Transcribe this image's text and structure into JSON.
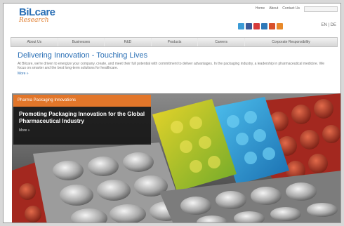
{
  "header": {
    "logo_main": "BiLcare",
    "logo_sub": "Research",
    "top_links": [
      "Home",
      "About",
      "Contact Us"
    ],
    "language": "EN | DE",
    "social_icons": [
      {
        "name": "twitter-icon",
        "color": "#3b9bd6"
      },
      {
        "name": "facebook-icon",
        "color": "#3b5998"
      },
      {
        "name": "youtube-icon",
        "color": "#d63b3b"
      },
      {
        "name": "linkedin-icon",
        "color": "#2f79b8"
      },
      {
        "name": "flickr-icon",
        "color": "#d8502a"
      },
      {
        "name": "rss-icon",
        "color": "#e8892a"
      }
    ]
  },
  "nav": {
    "items": [
      "About Us",
      "Businesses",
      "R&D",
      "Products",
      "Careers",
      "Corporate Responsibility"
    ]
  },
  "intro": {
    "title": "Delivering Innovation - Touching Lives",
    "body": "At Bilcare, we're driven to energize your company, create, and meet their full potential with commitment to deliver advantages. In the packaging industry, a leadership in pharmaceutical medicine. We focus on smarter and the best long-term solutions for healthcare.",
    "more": "More »"
  },
  "banner": {
    "tab_label": "Pharma Packaging Innovations",
    "title": "Promoting Packaging Innovation for the Global Pharmaceutical Industry",
    "more": "More »",
    "colors": {
      "orange": "#e2762a",
      "blue": "#2a9bd6",
      "green": "#7fb82a",
      "yellow": "#e8d02a",
      "red": "#b8322a"
    }
  }
}
